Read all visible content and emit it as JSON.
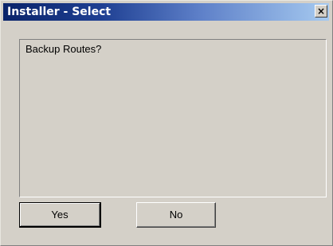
{
  "window": {
    "title": "Installer - Select",
    "close_glyph": "×"
  },
  "message": {
    "text": "Backup Routes?"
  },
  "buttons": {
    "yes_label": "Yes",
    "no_label": "No"
  },
  "colors": {
    "titlebar_start": "#0a246a",
    "titlebar_end": "#a6caf0",
    "dialog_face": "#d4d0c8"
  }
}
